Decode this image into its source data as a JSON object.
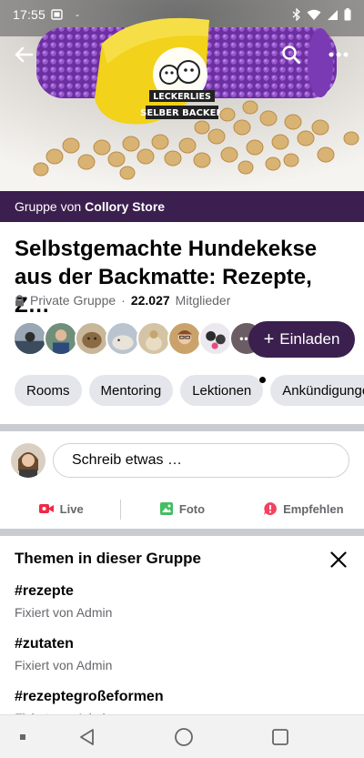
{
  "status_bar": {
    "time": "17:55",
    "time_icon": "screenshot-icon",
    "dash": "-",
    "icons": [
      "bluetooth-icon",
      "wifi-icon",
      "signal-icon",
      "battery-icon"
    ]
  },
  "cover": {
    "logo_line1": "LECKERLIES",
    "logo_line2": "SELBER BACKEN"
  },
  "group_bar": {
    "prefix": "Gruppe von",
    "owner": "Collory Store"
  },
  "group": {
    "title_line1": "Selbstgemachte Hundekekse",
    "title_line2": "aus der Backmatte: Rezepte, Z…",
    "privacy": "Private Gruppe",
    "separator": "·",
    "member_count": "22.027",
    "members_label": "Mitglieder"
  },
  "avatars": {
    "more_label": "•••"
  },
  "invite_button": {
    "plus": "+",
    "label": "Einladen"
  },
  "chips": [
    {
      "label": "Rooms"
    },
    {
      "label": "Mentoring"
    },
    {
      "label": "Lektionen"
    },
    {
      "label": "Ankündigungen"
    }
  ],
  "composer": {
    "placeholder": "Schreib etwas …"
  },
  "actions": [
    {
      "label": "Live",
      "icon": "live-video-icon",
      "color": "#f02849"
    },
    {
      "label": "Foto",
      "icon": "photo-icon",
      "color": "#45bd62"
    },
    {
      "label": "Empfehlen",
      "icon": "recommend-icon",
      "color": "#f3425f"
    }
  ],
  "topics": {
    "title": "Themen in dieser Gruppe",
    "items": [
      {
        "tag": "#rezepte",
        "sub": "Fixiert von Admin"
      },
      {
        "tag": "#zutaten",
        "sub": "Fixiert von Admin"
      },
      {
        "tag": "#rezeptegroßeformen",
        "sub": "Fixiert von Admin"
      }
    ]
  },
  "colors": {
    "brand_purple": "#3b1f4f",
    "chip_bg": "#e4e6eb",
    "secondary_text": "#65676b"
  }
}
